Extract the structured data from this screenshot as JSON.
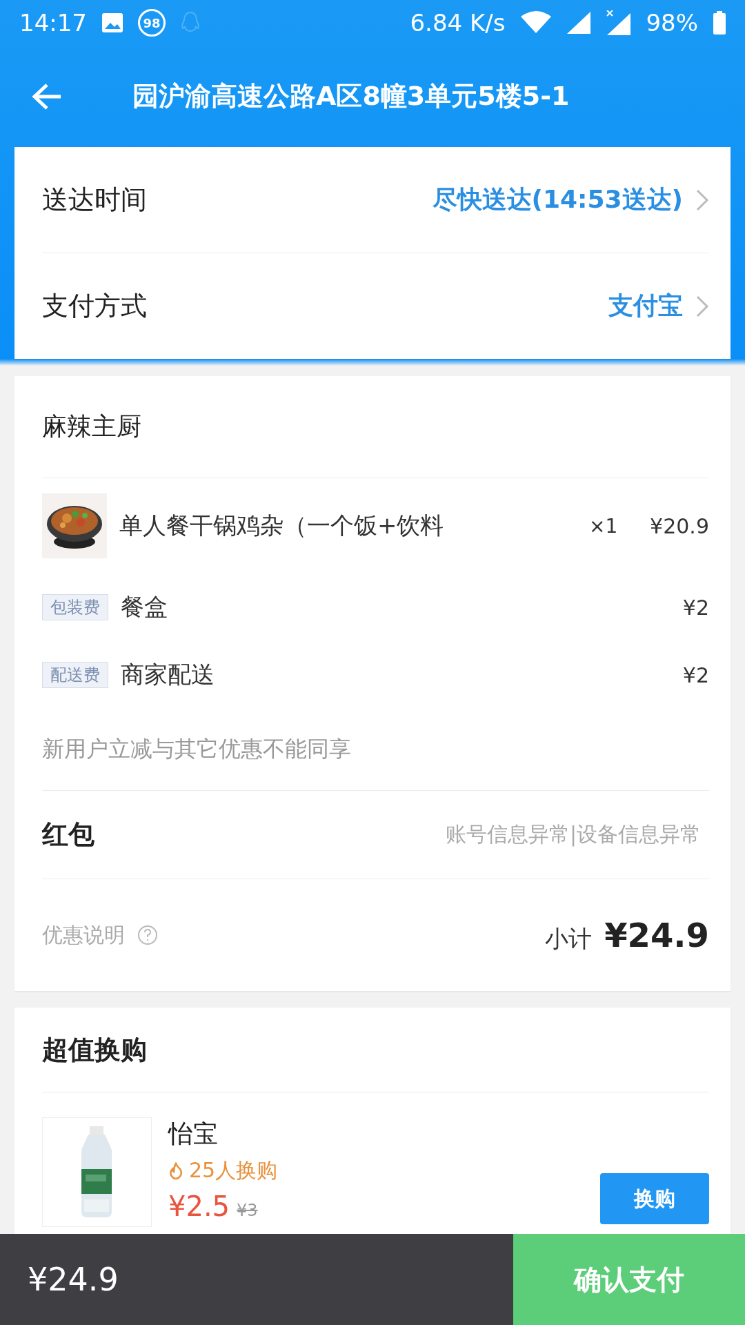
{
  "status_bar": {
    "time": "14:17",
    "badge": "98",
    "speed": "6.84 K/s",
    "battery": "98%"
  },
  "header": {
    "title": "园沪渝高速公路A区8幢3单元5楼5-1"
  },
  "delivery_card": {
    "rows": [
      {
        "label": "送达时间",
        "value": "尽快送达(14:53送达)"
      },
      {
        "label": "支付方式",
        "value": "支付宝"
      }
    ]
  },
  "order": {
    "shop": "麻辣主厨",
    "items": [
      {
        "kind": "dish",
        "name": "单人餐干锅鸡杂（一个饭+饮料",
        "quantity": "×1",
        "price": "¥20.9"
      },
      {
        "kind": "fee",
        "tag": "包装费",
        "name": "餐盒",
        "price": "¥2"
      },
      {
        "kind": "fee",
        "tag": "配送费",
        "name": "商家配送",
        "price": "¥2"
      }
    ],
    "note": "新用户立减与其它优惠不能同享",
    "red_packet": {
      "label": "红包",
      "value": "账号信息异常|设备信息异常"
    },
    "discount_info": "优惠说明",
    "subtotal_label": "小计",
    "subtotal": "¥24.9"
  },
  "upsell": {
    "title": "超值换购",
    "items": [
      {
        "name": "怡宝",
        "buyers": "25人换购",
        "price": "¥2.5",
        "original_price": "¥3",
        "button": "换购"
      }
    ]
  },
  "bottom_bar": {
    "total": "¥24.9",
    "pay_button": "确认支付"
  }
}
